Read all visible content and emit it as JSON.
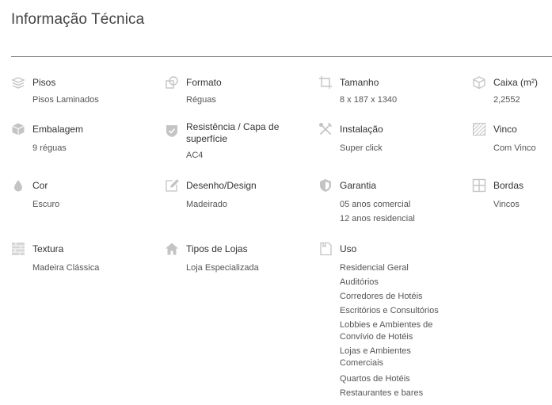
{
  "title": "Informação Técnica",
  "specs": {
    "pisos": {
      "label": "Pisos",
      "values": [
        "Pisos Laminados"
      ]
    },
    "formato": {
      "label": "Formato",
      "values": [
        "Réguas"
      ]
    },
    "tamanho": {
      "label": "Tamanho",
      "values": [
        "8 x 187 x 1340"
      ]
    },
    "caixa": {
      "label": "Caixa (m²)",
      "values": [
        "2,2552"
      ]
    },
    "embalagem": {
      "label": "Embalagem",
      "values": [
        "9 réguas"
      ]
    },
    "resistencia": {
      "label": "Resistência / Capa de superfície",
      "values": [
        "AC4"
      ]
    },
    "instalacao": {
      "label": "Instalação",
      "values": [
        "Super click"
      ]
    },
    "vinco": {
      "label": "Vinco",
      "values": [
        "Com Vinco"
      ]
    },
    "cor": {
      "label": "Cor",
      "values": [
        "Escuro"
      ]
    },
    "desenho": {
      "label": "Desenho/Design",
      "values": [
        "Madeirado"
      ]
    },
    "garantia": {
      "label": "Garantia",
      "values": [
        "05 anos comercial",
        "12 anos residencial"
      ]
    },
    "bordas": {
      "label": "Bordas",
      "values": [
        "Vincos"
      ]
    },
    "textura": {
      "label": "Textura",
      "values": [
        "Madeira Clássica"
      ]
    },
    "lojas": {
      "label": "Tipos de Lojas",
      "values": [
        "Loja Especializada"
      ]
    },
    "uso": {
      "label": "Uso",
      "values": [
        "Residencial Geral",
        "Auditórios",
        "Corredores de Hotéis",
        "Escritórios e Consultórios",
        "Lobbies e Ambientes de Convívio de Hotéis",
        "Lojas e Ambientes Comerciais",
        "Quartos de Hotéis",
        "Restaurantes e bares"
      ]
    }
  },
  "icons": {
    "pisos": "layers-icon",
    "formato": "shapes-icon",
    "tamanho": "dimensions-icon",
    "caixa": "box-icon",
    "embalagem": "package-icon",
    "resistencia": "shield-check-icon",
    "instalacao": "tools-icon",
    "vinco": "hatch-icon",
    "cor": "drop-icon",
    "desenho": "pencil-icon",
    "garantia": "shield-icon",
    "bordas": "grid-icon",
    "textura": "texture-icon",
    "lojas": "house-icon",
    "uso": "document-icon"
  },
  "colors": {
    "icon": "#c4c4c4",
    "label": "#333333",
    "value": "#555555",
    "divider": "#777777"
  }
}
